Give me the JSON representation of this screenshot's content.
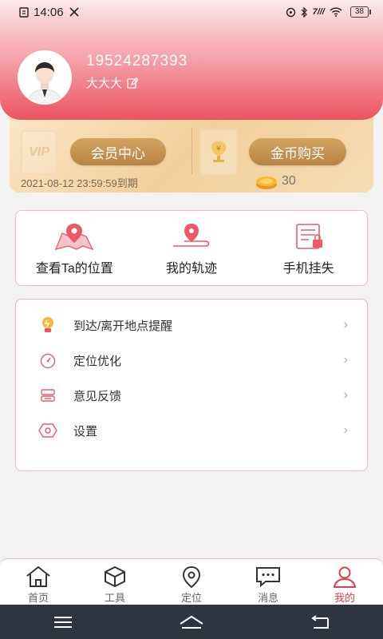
{
  "status_bar": {
    "time": "14:06",
    "battery": "38",
    "signal_text": "7///"
  },
  "profile": {
    "phone": "19524287393",
    "nickname": "大大大"
  },
  "vip": {
    "badge": "VIP",
    "member_center": "会员中心",
    "coin_purchase": "金币购买",
    "expire": "2021-08-12 23:59:59到期",
    "coins": "30"
  },
  "quick_actions": [
    {
      "label": "查看Ta的位置",
      "icon": "map-pin-icon"
    },
    {
      "label": "我的轨迹",
      "icon": "track-icon"
    },
    {
      "label": "手机挂失",
      "icon": "lock-document-icon"
    }
  ],
  "menu": [
    {
      "label": "到达/离开地点提醒",
      "icon": "bulb-icon"
    },
    {
      "label": "定位优化",
      "icon": "speedometer-icon"
    },
    {
      "label": "意见反馈",
      "icon": "feedback-icon"
    },
    {
      "label": "设置",
      "icon": "hexagon-settings-icon"
    }
  ],
  "tabs": [
    {
      "label": "首页",
      "icon": "home-icon"
    },
    {
      "label": "工具",
      "icon": "box-icon"
    },
    {
      "label": "定位",
      "icon": "location-icon"
    },
    {
      "label": "消息",
      "icon": "message-icon"
    },
    {
      "label": "我的",
      "icon": "user-icon"
    }
  ],
  "colors": {
    "accent": "#e23d4a",
    "gold": "#c4904d"
  }
}
